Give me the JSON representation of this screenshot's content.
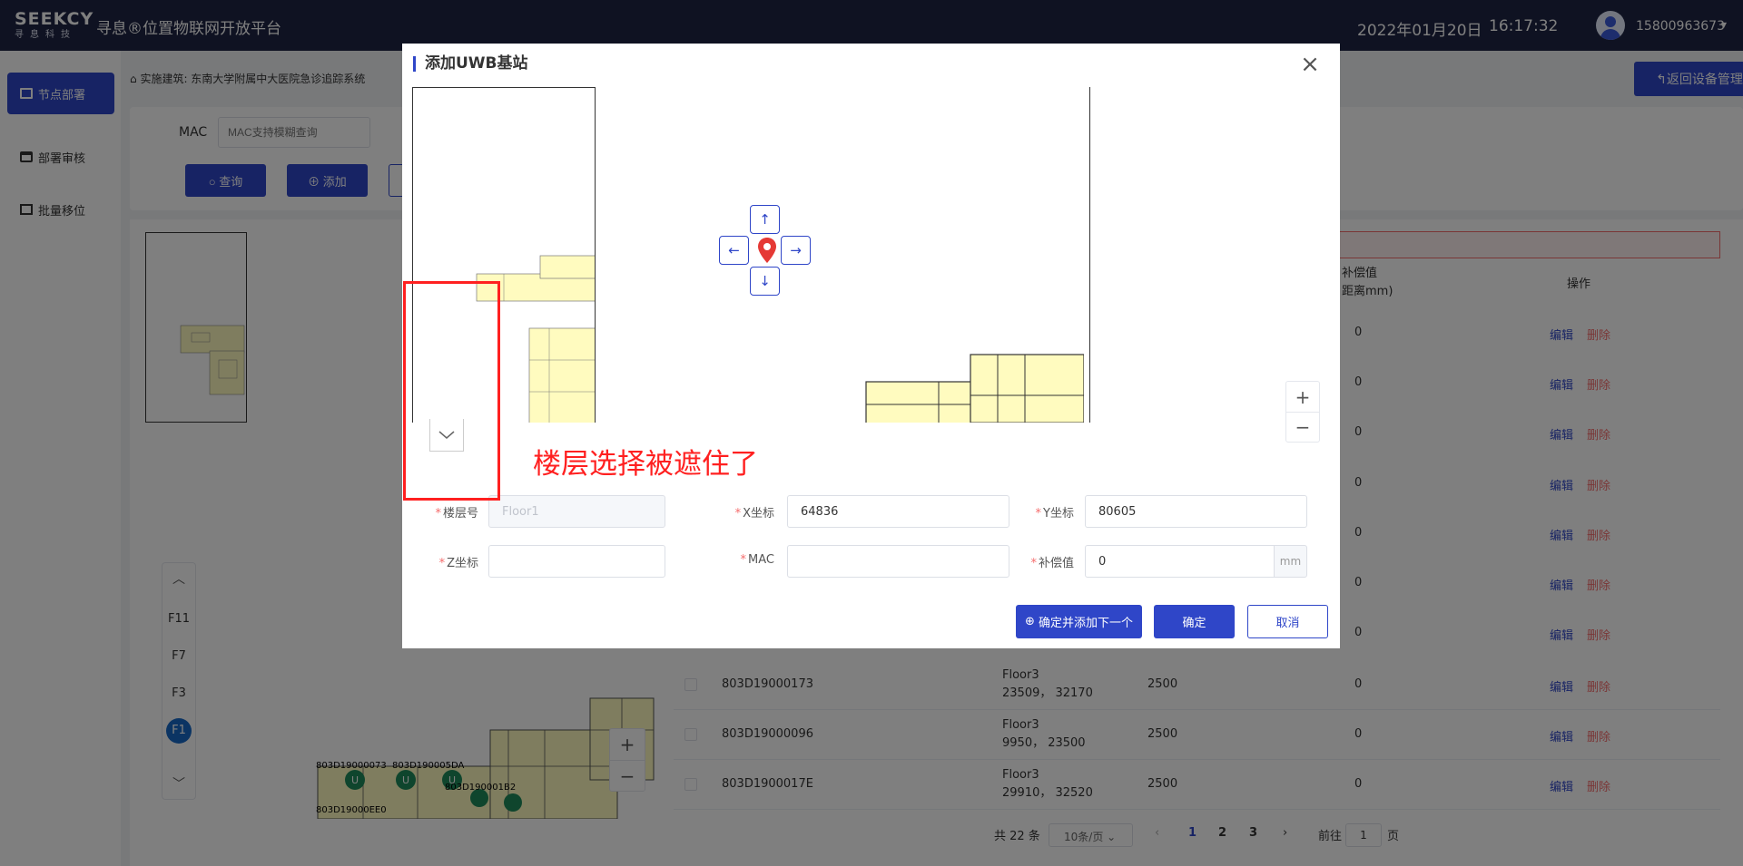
{
  "header": {
    "logo_text": "SEEKCY",
    "logo_sub": "寻息科技",
    "app_title": "寻息®位置物联网开放平台",
    "date": "2022年01月20日",
    "time": "16:17:32",
    "user": "15800963673"
  },
  "sidebar": {
    "items": [
      {
        "label": "节点部署"
      },
      {
        "label": "部署审核"
      },
      {
        "label": "批量移位"
      }
    ]
  },
  "toolbar": {
    "building": "实施建筑: 东南大学附属中大医院急诊追踪系统",
    "back_label": "返回设备管理",
    "mac_label": "MAC",
    "mac_placeholder": "MAC支持模糊查询",
    "query_label": "查询",
    "add_label": "添加"
  },
  "floor_selector": {
    "floors": [
      "F11",
      "F7",
      "F3",
      "F1"
    ],
    "active": "F1"
  },
  "map_labels": {
    "tag1": "803D19000073",
    "tag2": "803D190005DA",
    "tag3": "803D190001B2",
    "tag4": "803D19000EE0"
  },
  "table": {
    "headers": {
      "compensation_line1": "补偿值",
      "compensation_line2": "距离mm)",
      "operation": "操作"
    },
    "visible_compensation": [
      "0",
      "0",
      "0",
      "0",
      "0",
      "0",
      "0"
    ],
    "rows": [
      {
        "mac": "803D19000173",
        "floor": "Floor3",
        "coord": "23509， 32170",
        "height": "2500",
        "comp": "0"
      },
      {
        "mac": "803D19000096",
        "floor": "Floor3",
        "coord": "9950， 23500",
        "height": "2500",
        "comp": "0"
      },
      {
        "mac": "803D1900017E",
        "floor": "Floor3",
        "coord": "29910， 32520",
        "height": "2500",
        "comp": "0"
      }
    ],
    "edit_label": "编辑",
    "delete_label": "删除"
  },
  "pagination": {
    "total": "共 22 条",
    "page_size": "10条/页",
    "pages": [
      "1",
      "2",
      "3"
    ],
    "active_page": "1",
    "goto_prefix": "前往",
    "goto_value": "1",
    "goto_suffix": "页"
  },
  "modal": {
    "title": "添加UWB基站",
    "annotation": "楼层选择被遮住了",
    "form": {
      "floor_label": "楼层号",
      "floor_value": "Floor1",
      "x_label": "X坐标",
      "x_value": "64836",
      "y_label": "Y坐标",
      "y_value": "80605",
      "z_label": "Z坐标",
      "z_value": "",
      "mac_label": "MAC",
      "mac_value": "",
      "comp_label": "补偿值",
      "comp_value": "0",
      "comp_unit": "mm"
    },
    "buttons": {
      "confirm_next": "确定并添加下一个",
      "confirm": "确定",
      "cancel": "取消"
    }
  },
  "colors": {
    "header_bg": "#1f2544",
    "primary": "#2f46c8",
    "danger": "#f56c6c",
    "annotation": "#ff2020",
    "map_fill": "#fffbbf"
  }
}
